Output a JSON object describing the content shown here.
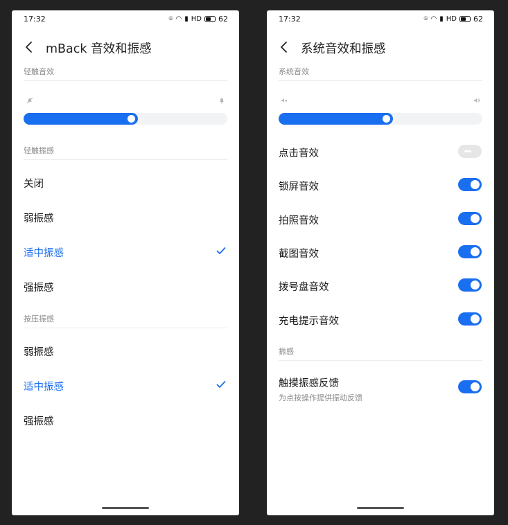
{
  "left": {
    "status": {
      "time": "17:32",
      "signal_text": "HD",
      "battery": "62"
    },
    "title": "mBack 音效和振感",
    "section_touch_sound": "轻触音效",
    "slider_touch_sound": {
      "value": 0.56
    },
    "section_touch_vibration": "轻触振感",
    "touch_vibration_options": [
      {
        "label": "关闭",
        "selected": false
      },
      {
        "label": "弱振感",
        "selected": false
      },
      {
        "label": "适中振感",
        "selected": true
      },
      {
        "label": "强振感",
        "selected": false
      }
    ],
    "section_press_vibration": "按压振感",
    "press_vibration_options": [
      {
        "label": "弱振感",
        "selected": false
      },
      {
        "label": "适中振感",
        "selected": true
      },
      {
        "label": "强振感",
        "selected": false
      }
    ]
  },
  "right": {
    "status": {
      "time": "17:32",
      "signal_text": "HD",
      "battery": "62"
    },
    "title": "系统音效和振感",
    "section_system_sound": "系统音效",
    "slider_system_sound": {
      "value": 0.56
    },
    "toggles": [
      {
        "label": "点击音效",
        "on": false
      },
      {
        "label": "锁屏音效",
        "on": true
      },
      {
        "label": "拍照音效",
        "on": true
      },
      {
        "label": "截图音效",
        "on": true
      },
      {
        "label": "拨号盘音效",
        "on": true
      },
      {
        "label": "充电提示音效",
        "on": true
      }
    ],
    "section_vibration": "振感",
    "haptic_feedback": {
      "label": "触摸振感反馈",
      "sub": "为点按操作提供振动反馈",
      "on": true
    }
  },
  "colors": {
    "accent": "#1a6ef0",
    "background": "#222222",
    "toggle_off": "#e6e6e6"
  }
}
